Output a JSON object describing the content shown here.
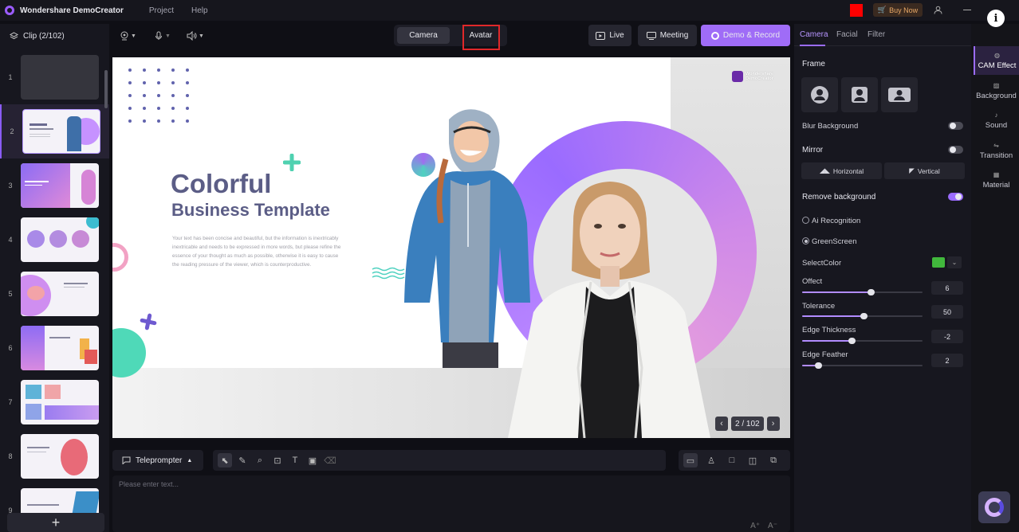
{
  "app": {
    "name": "Wondershare DemoCreator",
    "menu": [
      "Project",
      "Help"
    ],
    "buy_now": "Buy Now"
  },
  "clips": {
    "header": "Clip (2/102)",
    "items": [
      {
        "num": "1"
      },
      {
        "num": "2"
      },
      {
        "num": "3"
      },
      {
        "num": "4"
      },
      {
        "num": "5"
      },
      {
        "num": "6"
      },
      {
        "num": "7"
      },
      {
        "num": "8"
      },
      {
        "num": "9"
      }
    ],
    "add": "+"
  },
  "toolbar": {
    "mode_tabs": {
      "camera": "Camera",
      "avatar": "Avatar"
    },
    "live": "Live",
    "meeting": "Meeting",
    "demo_record": "Demo & Record"
  },
  "slide": {
    "title": "Colorful",
    "subtitle": "Business Template",
    "body": "Your text has been concise and beautiful, but the information is inextricably inextricable and needs to be expressed in more words, but please refine the essence of your thought as much as possible, otherwise it is easy to cause the reading pressure of the viewer, which is counterproductive.",
    "logo_line1": "Wondershare",
    "logo_line2": "DemoCreator"
  },
  "pager": {
    "label": "2 / 102",
    "prev": "‹",
    "next": "›"
  },
  "teleprompter": {
    "label": "Teleprompter",
    "placeholder": "Please enter text...",
    "font_up": "A⁺",
    "font_down": "A⁻"
  },
  "properties": {
    "tabs": [
      "Camera",
      "Facial",
      "Filter"
    ],
    "frame_label": "Frame",
    "blur_background": "Blur Background",
    "mirror": "Mirror",
    "horizontal": "Horizontal",
    "vertical": "Vertical",
    "remove_background": "Remove background",
    "ai_recognition": "Ai Recognition",
    "green_screen": "GreenScreen",
    "select_color": "SelectColor",
    "select_color_value": "#41b83c",
    "sliders": [
      {
        "label": "Offect",
        "value": "6",
        "level": 0.57
      },
      {
        "label": "Tolerance",
        "value": "50",
        "level": 0.51
      },
      {
        "label": "Edge Thickness",
        "value": "-2",
        "level": 0.41
      },
      {
        "label": "Edge Feather",
        "value": "2",
        "level": 0.13
      }
    ]
  },
  "side_nav": [
    "CAM Effect",
    "Background",
    "Sound",
    "Transition",
    "Material"
  ],
  "colors": {
    "accent": "#9b6cff",
    "annotation": "#e0282a",
    "record": "#ff0000"
  }
}
